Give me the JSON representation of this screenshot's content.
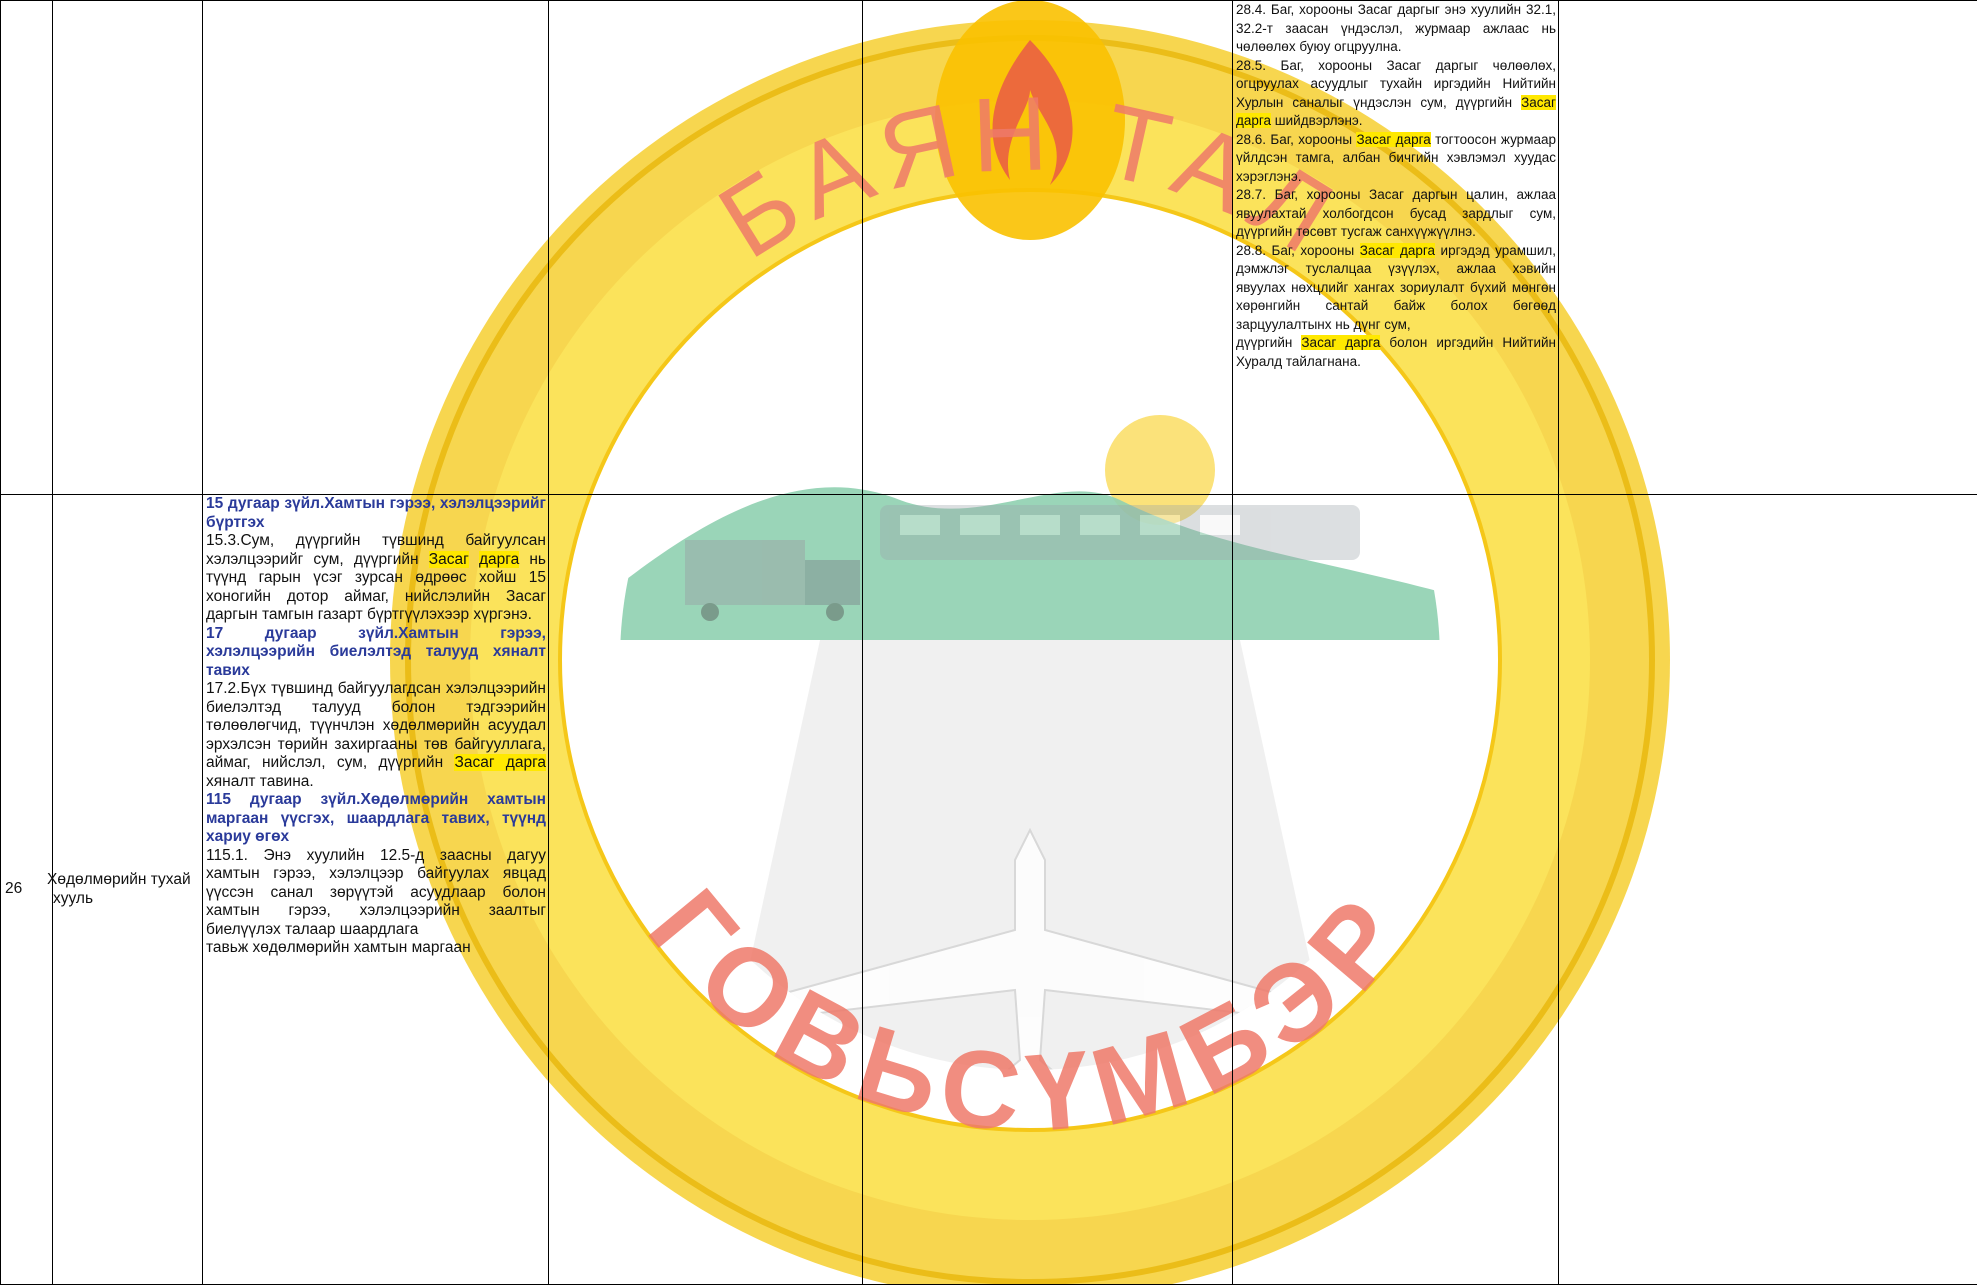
{
  "watermark": {
    "top_text": "БАЯН ТАЛ",
    "bottom_text": "ГОВЬСҮМБЭР",
    "colors": {
      "ring": "#f5c51a",
      "ring_dark": "#e8a800",
      "red": "#e85a4a",
      "mountain": "#7fc9a8",
      "sun": "#fbe27a",
      "runway": "#d8d8d8"
    },
    "icons": [
      "emblem-seal-icon",
      "flame-icon",
      "mountain-icon",
      "sun-icon",
      "train-icon",
      "truck-icon",
      "airplane-icon",
      "runway-icon"
    ]
  },
  "row1": {
    "col6_text": [
      {
        "type": "text",
        "parts": [
          {
            "t": "28.4. Баг, хорооны Засаг даргыг энэ хуулийн 32.1, 32.2-т заасан үндэслэл, журмаар ажлаас нь чөлөөлөх буюу огцруулна."
          }
        ]
      },
      {
        "type": "text",
        "parts": [
          {
            "t": "28.5. Баг, хорооны Засаг даргыг чөлөөлөх, огцруулах асуудлыг тухайн иргэдийн Нийтийн Хурлын саналыг үндэслэн сум, дүүргийн "
          },
          {
            "t": "Засаг",
            "hl": true
          },
          {
            "t": " "
          },
          {
            "t": "дарга",
            "hl": true
          },
          {
            "t": " шийдвэрлэнэ."
          }
        ]
      },
      {
        "type": "text",
        "parts": [
          {
            "t": "28.6. Баг, хорооны "
          },
          {
            "t": "Засаг дарга",
            "hl": true
          },
          {
            "t": " тогтоосон журмаар үйлдсэн тамга, албан бичгийн хэвлэмэл хуудас хэрэглэнэ."
          }
        ]
      },
      {
        "type": "text",
        "parts": [
          {
            "t": "28.7. Баг, хорооны Засаг даргын цалин, ажлаа явуулахтай холбогдсон бусад зардлыг сум, дүүргийн төсөвт тусгаж санхүүжүүлнэ."
          }
        ]
      },
      {
        "type": "text",
        "parts": [
          {
            "t": "28.8. Баг, хорооны "
          },
          {
            "t": "Засаг дарга",
            "hl": true
          },
          {
            "t": " иргэдэд урамшил, дэмжлэг туслалцаа үзүүлэх, ажлаа хэвийн явуулах нөхцлийг хангах зориулалт бүхий мөнгөн хөрөнгийн сантай байж болох бөгөөд зарцуулалтынх нь дүнг сум,"
          }
        ]
      },
      {
        "type": "text",
        "parts": [
          {
            "t": "дүүргийн "
          },
          {
            "t": "Засаг дарга",
            "hl": true
          },
          {
            "t": " болон иргэдийн Нийтийн Хуралд тайлагнана."
          }
        ]
      }
    ]
  },
  "row2": {
    "number": "26",
    "law_name": "Хөдөлмөрийн тухай хууль",
    "col3_text": [
      {
        "type": "head",
        "parts": [
          {
            "t": "15 дугаар зүйл.Хамтын гэрээ, хэлэлцээрийг бүртгэх"
          }
        ]
      },
      {
        "type": "text",
        "parts": [
          {
            "t": "15.3.Сум, дүүргийн түвшинд байгуулсан хэлэлцээрийг сум, дүүргийн "
          },
          {
            "t": "Засаг",
            "hl": true
          },
          {
            "t": " "
          },
          {
            "t": "дарга",
            "hl": true
          },
          {
            "t": " нь түүнд гарын үсэг зурсан өдрөөс хойш 15 хоногийн дотор аймаг, нийслэлийн Засаг даргын тамгын газарт бүртгүүлэхээр хүргэнэ."
          }
        ]
      },
      {
        "type": "head",
        "parts": [
          {
            "t": "17 дугаар зүйл.Хамтын гэрээ, хэлэлцээрийн биелэлтэд талууд хяналт тавих"
          }
        ]
      },
      {
        "type": "text",
        "parts": [
          {
            "t": "17.2.Бүх түвшинд байгуулагдсан хэлэлцээрийн биелэлтэд талууд болон тэдгээрийн төлөөлөгчид, түүнчлэн хөдөлмөрийн асуудал эрхэлсэн төрийн захиргааны төв байгууллага, аймаг, нийслэл, сум, дүүргийн "
          },
          {
            "t": "Засаг дарга",
            "hl": true
          },
          {
            "t": " хяналт тавина."
          }
        ]
      },
      {
        "type": "head",
        "parts": [
          {
            "t": "115 дугаар зүйл.Хөдөлмөрийн хамтын маргаан үүсгэх, шаардлага тавих, түүнд хариу өгөх"
          }
        ]
      },
      {
        "type": "text",
        "parts": [
          {
            "t": "115.1. Энэ хуулийн 12.5-д заасны дагуу хамтын гэрээ, хэлэлцээр байгуулах явцад үүссэн санал зөрүүтэй асуудлаар болон хамтын гэрээ, хэлэлцээрийн заалтыг биелүүлэх талаар шаардлага"
          }
        ]
      },
      {
        "type": "text",
        "parts": [
          {
            "t": "тавьж хөдөлмөрийн хамтын маргаан"
          }
        ]
      }
    ]
  }
}
